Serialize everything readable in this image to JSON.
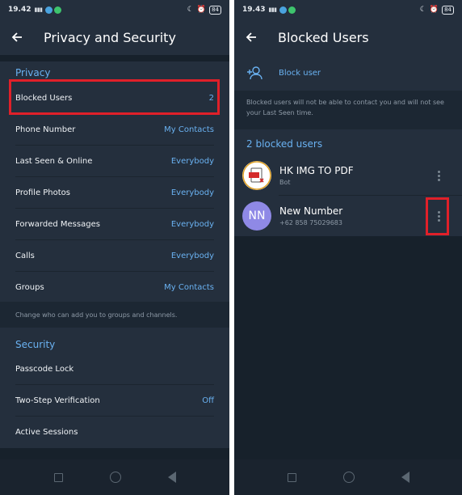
{
  "left": {
    "status_bar": {
      "time": "19.42",
      "battery": "84"
    },
    "app_bar": {
      "title": "Privacy and Security"
    },
    "privacy": {
      "title": "Privacy",
      "items": [
        {
          "label": "Blocked Users",
          "value": "2"
        },
        {
          "label": "Phone Number",
          "value": "My Contacts"
        },
        {
          "label": "Last Seen & Online",
          "value": "Everybody"
        },
        {
          "label": "Profile Photos",
          "value": "Everybody"
        },
        {
          "label": "Forwarded Messages",
          "value": "Everybody"
        },
        {
          "label": "Calls",
          "value": "Everybody"
        },
        {
          "label": "Groups",
          "value": "My Contacts"
        }
      ],
      "hint": "Change who can add you to groups and channels."
    },
    "security": {
      "title": "Security",
      "items": [
        {
          "label": "Passcode Lock",
          "value": ""
        },
        {
          "label": "Two-Step Verification",
          "value": "Off"
        },
        {
          "label": "Active Sessions",
          "value": ""
        }
      ]
    },
    "highlight_color": "#e02029",
    "accent_color": "#6ab2f2"
  },
  "right": {
    "status_bar": {
      "time": "19.43",
      "battery": "84"
    },
    "app_bar": {
      "title": "Blocked Users"
    },
    "block_user_label": "Block user",
    "info": "Blocked users will not be able to contact you and will not see your Last Seen time.",
    "section_title": "2 blocked users",
    "users": [
      {
        "name": "HK IMG TO PDF",
        "subtitle": "Bot",
        "avatar_icon": "pdf-icon"
      },
      {
        "name": "New Number",
        "subtitle": "+62 858 75029683",
        "initials": "NN",
        "avatar_color": "#8f89e6"
      }
    ]
  }
}
